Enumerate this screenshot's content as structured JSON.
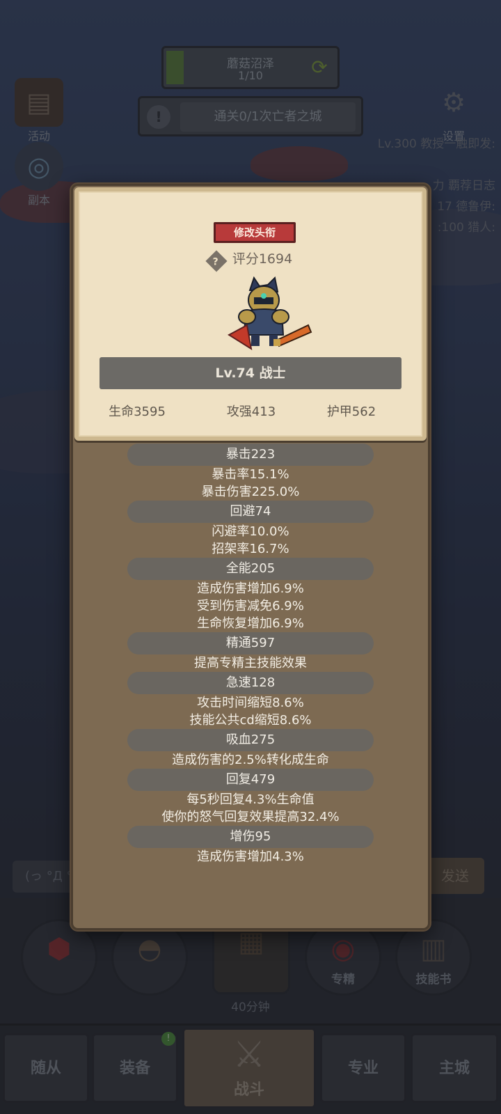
{
  "hud": {
    "area_name": "蘑菇沼泽",
    "area_progress": "1/10",
    "area_progress_fraction": 0.1,
    "quest_text": "通关0/1次亡者之城",
    "activity_label": "活动",
    "dungeon_label": "副本",
    "settings_label": "设置",
    "chat_lines": [
      "Lv.300 教授一触即发:",
      "力 覇荐日志",
      "17 德鲁伊:",
      ":100 猎人:"
    ]
  },
  "modal": {
    "edit_title_button": "修改头衔",
    "score": "评分1694",
    "level_class": "Lv.74 战士",
    "base_stats": {
      "hp": "生命3595",
      "attack": "攻强413",
      "armor": "护甲562"
    },
    "stat_groups": [
      {
        "head": "暴击223",
        "lines": [
          "暴击率15.1%",
          "暴击伤害225.0%"
        ]
      },
      {
        "head": "回避74",
        "lines": [
          "闪避率10.0%",
          "招架率16.7%"
        ]
      },
      {
        "head": "全能205",
        "lines": [
          "造成伤害增加6.9%",
          "受到伤害减免6.9%",
          "生命恢复增加6.9%"
        ]
      },
      {
        "head": "精通597",
        "lines": [
          "提高专精主技能效果"
        ]
      },
      {
        "head": "急速128",
        "lines": [
          "攻击时间缩短8.6%",
          "技能公共cd缩短8.6%"
        ]
      },
      {
        "head": "吸血275",
        "lines": [
          "造成伤害的2.5%转化成生命"
        ]
      },
      {
        "head": "回复479",
        "lines": [
          "每5秒回复4.3%生命值",
          "使你的怒气回复效果提高32.4%"
        ]
      },
      {
        "head": "增伤95",
        "lines": [
          "造成伤害增加4.3%"
        ]
      }
    ]
  },
  "chat": {
    "input_partial": "(っ °Д °",
    "send_label": "发送"
  },
  "bottom_buttons": {
    "timer": "40分钟",
    "specialization": "专精",
    "skill_book": "技能书"
  },
  "nav": {
    "tabs": [
      "随从",
      "装备",
      "战斗",
      "专业",
      "主城"
    ],
    "equip_badge": "!"
  },
  "colors": {
    "accent_red": "#b83a3a",
    "parchment": "#efe1c4",
    "panel_brown": "#7d6a52"
  }
}
